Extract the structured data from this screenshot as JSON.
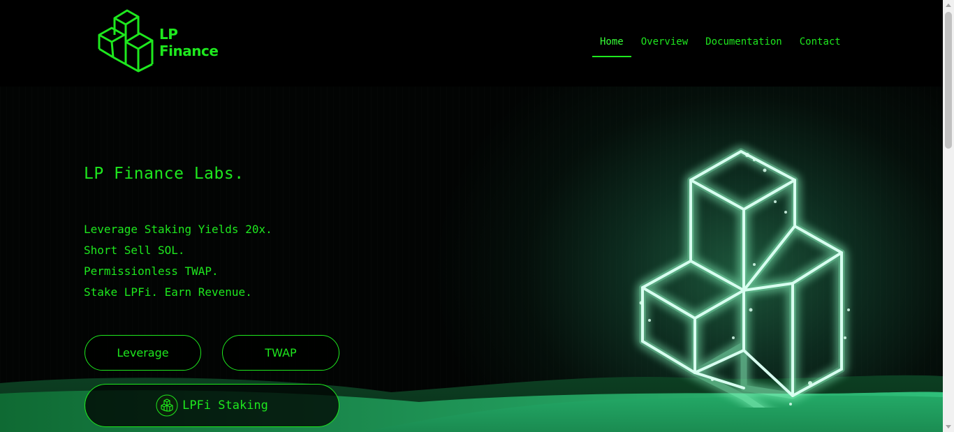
{
  "header": {
    "logo": {
      "line1": "LP",
      "line2": "Finance"
    },
    "nav": [
      {
        "label": "Home",
        "active": true
      },
      {
        "label": "Overview",
        "active": false
      },
      {
        "label": "Documentation",
        "active": false
      },
      {
        "label": "Contact",
        "active": false
      }
    ]
  },
  "hero": {
    "title": "LP Finance Labs.",
    "taglines": [
      "Leverage Staking Yields 20x.",
      "Short Sell SOL.",
      "Permissionless TWAP.",
      "Stake LPFi. Earn Revenue."
    ],
    "buttons": {
      "leverage": "Leverage",
      "twap": "TWAP",
      "staking": "LPFi Staking"
    }
  },
  "colors": {
    "accent": "#1ee81e",
    "background": "#000000",
    "hill_green": "#1e9a58",
    "glow": "#b8ffd8"
  },
  "icons": [
    "lp-finance-cube-logo-icon",
    "lpfi-staking-icon",
    "glowing-cubes-illustration"
  ]
}
